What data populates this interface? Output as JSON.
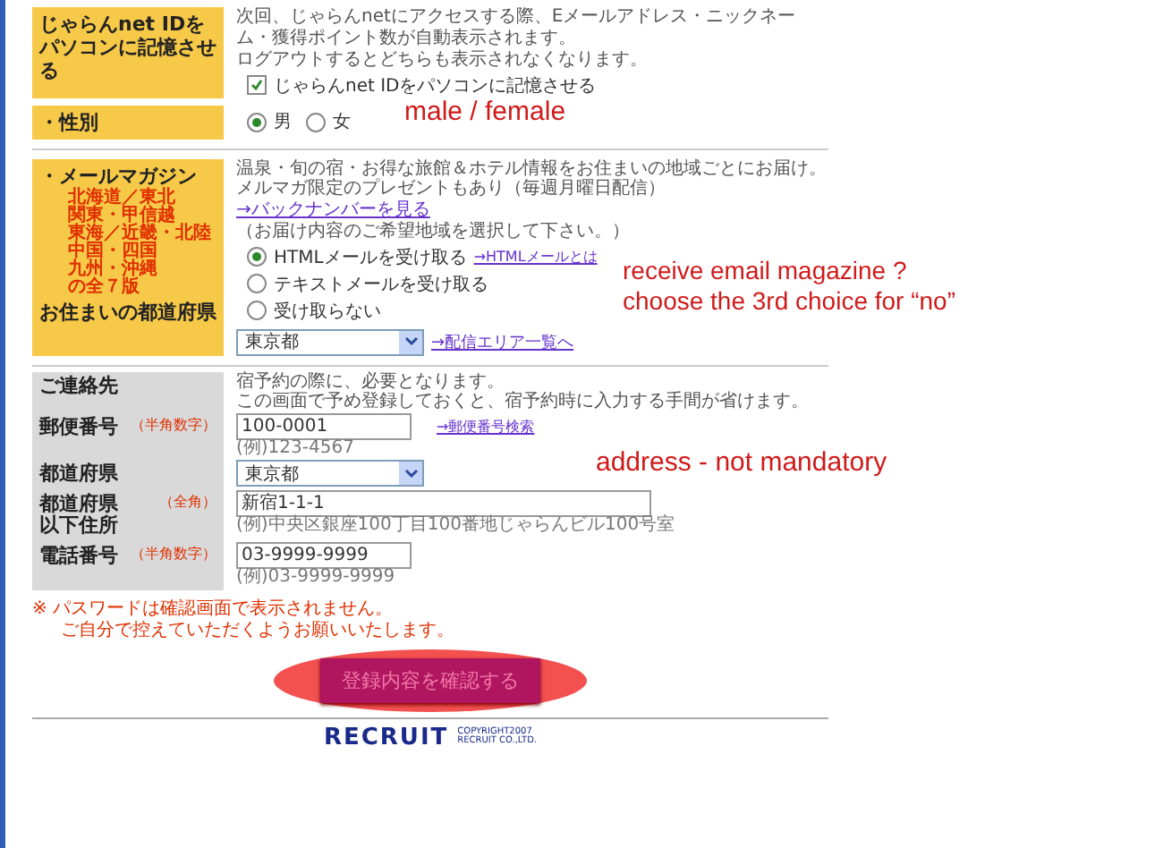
{
  "remember_id": {
    "label": "じゃらんnet IDをパソコンに記憶させる",
    "description": [
      "次回、じゃらんnetにアクセスする際、Eメールアドレス・ニックネーム・獲得ポイント数が自動表示されます。",
      "ログアウトするとどちらも表示されなくなります。"
    ],
    "checkbox": {
      "label": "じゃらんnet IDをパソコンに記憶させる",
      "checked": true
    }
  },
  "gender": {
    "label": "・性別",
    "options": [
      {
        "label": "男",
        "selected": true
      },
      {
        "label": "女",
        "selected": false
      }
    ]
  },
  "newsletter": {
    "label": "・メールマガジン",
    "regions": [
      "北海道／東北",
      "関東・甲信越",
      "東海／近畿・北陸",
      "中国・四国",
      "九州・沖縄",
      "の全７版"
    ],
    "prefecture_label": "お住まいの都道府県",
    "description": "温泉・旬の宿・お得な旅館＆ホテル情報をお住まいの地域ごとにお届け。メルマガ限定のプレゼントもあり（毎週月曜日配信）",
    "backnumber_link": "→バックナンバーを見る",
    "instruction": "（お届け内容のご希望地域を選択して下さい。）",
    "options": [
      {
        "label": "HTMLメールを受け取る",
        "selected": true,
        "link": "→HTMLメールとは"
      },
      {
        "label": "テキストメールを受け取る",
        "selected": false
      },
      {
        "label": "受け取らない",
        "selected": false
      }
    ],
    "prefecture": "東京都",
    "area_link": "→配信エリア一覧へ"
  },
  "contact": {
    "label": "ご連絡先",
    "description": [
      "宿予約の際に、必要となります。",
      "この画面で予め登録しておくと、宿予約時に入力する手間が省けます。"
    ],
    "fields": [
      {
        "kind": "input",
        "label": "郵便番号",
        "note": "（半角数字）",
        "value": "100-0001",
        "link": "→郵便番号検索",
        "hint": "(例)123-4567"
      },
      {
        "kind": "select",
        "label": "都道府県",
        "value": "東京都"
      },
      {
        "kind": "wide_input",
        "label": "都道府県以下住所",
        "note": "（全角）",
        "value": "新宿1-1-1",
        "hint": "(例)中央区銀座100丁目100番地じゃらんビル100号室"
      },
      {
        "kind": "input",
        "label": "電話番号",
        "note": "（半角数字）",
        "value": "03-9999-9999",
        "hint": "(例)03-9999-9999"
      }
    ]
  },
  "notice": [
    "※ パスワードは確認画面で表示されません。",
    "ご自分で控えていただくようお願いいたします。"
  ],
  "submit_button": {
    "label": "登録内容を確認する",
    "circled": true
  },
  "annotations": [
    "male / female",
    "receive email magazine ?",
    "choose the 3rd choice for “no”",
    "address - not mandatory"
  ],
  "footer": {
    "logo": "RECRUIT",
    "copyright": [
      "COPYRIGHT2007",
      "RECRUIT CO.,LTD."
    ]
  }
}
